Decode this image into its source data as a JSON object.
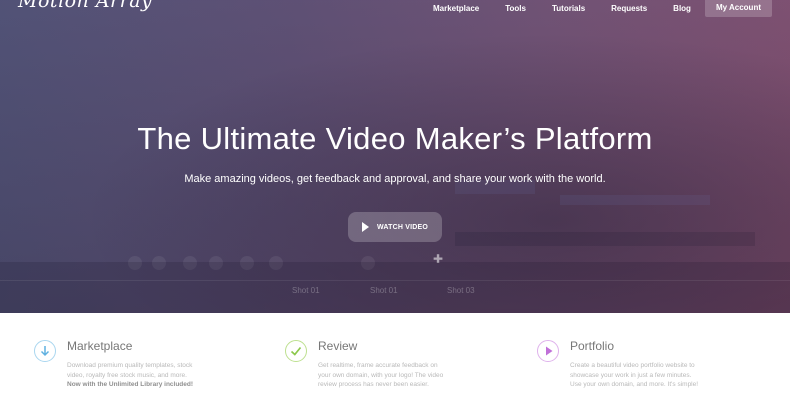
{
  "header": {
    "logo_text": "Motion Array",
    "nav": [
      "Marketplace",
      "Tools",
      "Tutorials",
      "Requests",
      "Blog"
    ],
    "account_label": "My Account"
  },
  "hero": {
    "title": "The Ultimate Video Maker’s Platform",
    "subtitle": "Make amazing videos, get feedback and approval, and share your work with the world.",
    "watch_label": "WATCH VIDEO",
    "background_shots": [
      "Shot 01",
      "Shot 01",
      "Shot 03"
    ]
  },
  "features": [
    {
      "title": "Marketplace",
      "icon": "download-arrow-icon",
      "icon_color": "#5fb0e0",
      "desc_lines": [
        "Download premium quality templates, stock",
        "video, royalty free stock music, and more."
      ],
      "desc_bold": "Now with the Unlimited Library included!"
    },
    {
      "title": "Review",
      "icon": "checkmark-icon",
      "icon_color": "#8cc84b",
      "desc_lines": [
        "Get realtime, frame accurate feedback on",
        "your own domain, with your logo! The video",
        "review process has never been easier."
      ]
    },
    {
      "title": "Portfolio",
      "icon": "play-icon",
      "icon_color": "#c070d8",
      "desc_lines": [
        "Create a beautiful video portfolio website to",
        "showcase your work in just a few minutes.",
        "Use your own domain, and more. It's simple!"
      ]
    }
  ],
  "colors": {
    "hero_left": "#4e4f74",
    "hero_right": "#7e4d6e",
    "feature_title": "#777777",
    "feature_desc": "#b9b9b9"
  }
}
